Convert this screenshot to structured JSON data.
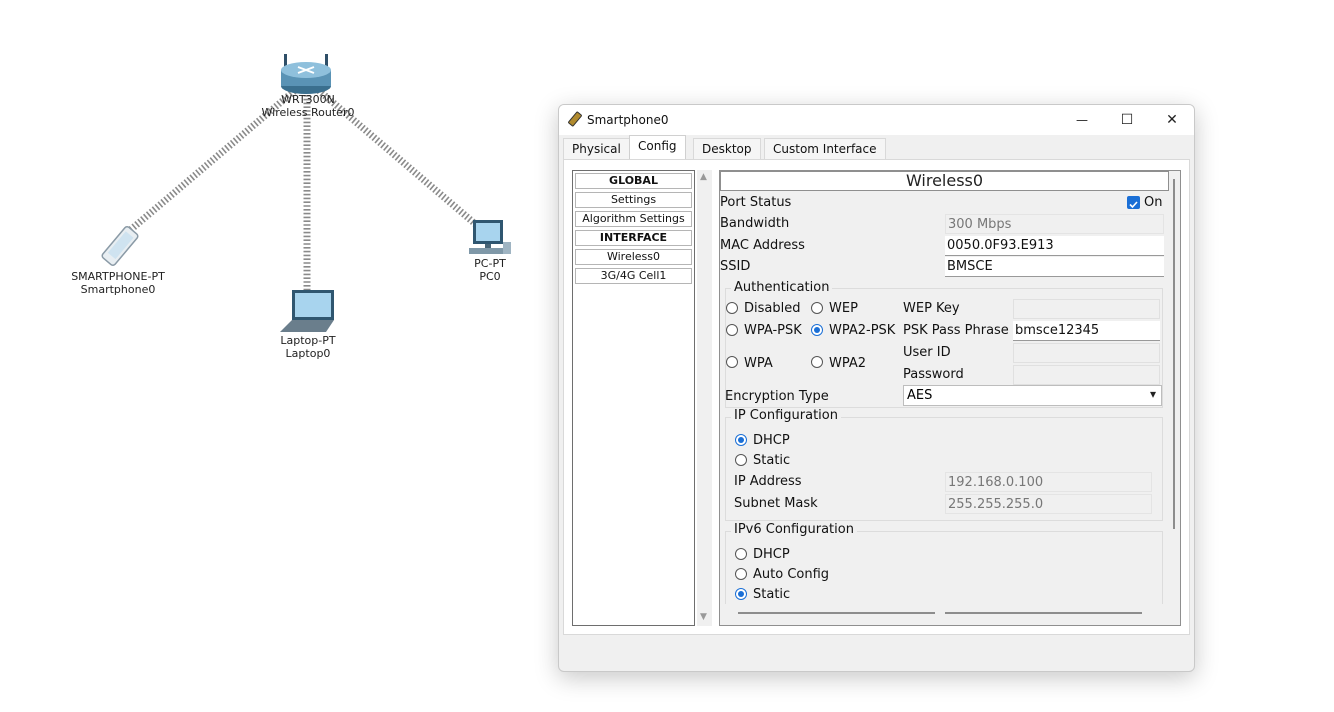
{
  "devices": {
    "router": {
      "line1": "WRT300N",
      "line2": "Wireless Router0"
    },
    "smartphone": {
      "line1": "SMARTPHONE-PT",
      "line2": "Smartphone0"
    },
    "laptop": {
      "line1": "Laptop-PT",
      "line2": "Laptop0"
    },
    "pc": {
      "line1": "PC-PT",
      "line2": "PC0"
    }
  },
  "window": {
    "title": "Smartphone0",
    "minimize_glyph": "—",
    "maximize_glyph": "☐",
    "close_glyph": "✕",
    "tabs": [
      "Physical",
      "Config",
      "Desktop",
      "Custom Interface"
    ],
    "active_tab": "Config"
  },
  "nav": {
    "items": [
      {
        "label": "GLOBAL",
        "header": true
      },
      {
        "label": "Settings",
        "header": false
      },
      {
        "label": "Algorithm Settings",
        "header": false
      },
      {
        "label": "INTERFACE",
        "header": true
      },
      {
        "label": "Wireless0",
        "header": false
      },
      {
        "label": "3G/4G Cell1",
        "header": false
      }
    ],
    "scroll_up": "▲",
    "scroll_down": "▼"
  },
  "panel": {
    "title": "Wireless0",
    "port_status": {
      "label": "Port Status",
      "checkbox_label": "On",
      "checked": true
    },
    "bandwidth": {
      "label": "Bandwidth",
      "value": "300 Mbps"
    },
    "mac": {
      "label": "MAC Address",
      "value": "0050.0F93.E913"
    },
    "ssid": {
      "label": "SSID",
      "value": "BMSCE"
    },
    "auth": {
      "title": "Authentication",
      "options": [
        "Disabled",
        "WEP",
        "WPA-PSK",
        "WPA2-PSK",
        "WPA",
        "WPA2"
      ],
      "selected": "WPA2-PSK",
      "wep_key_label": "WEP Key",
      "psk_label": "PSK Pass Phrase",
      "psk_value": "bmsce12345",
      "userid_label": "User ID",
      "password_label": "Password"
    },
    "encryption": {
      "label": "Encryption Type",
      "value": "AES",
      "arrow": "▾"
    },
    "ip_config": {
      "title": "IP Configuration",
      "dhcp_label": "DHCP",
      "static_label": "Static",
      "selected": "DHCP",
      "ip_label": "IP Address",
      "ip_value": "192.168.0.100",
      "mask_label": "Subnet Mask",
      "mask_value": "255.255.255.0"
    },
    "ipv6_config": {
      "title": "IPv6 Configuration",
      "dhcp_label": "DHCP",
      "auto_label": "Auto Config",
      "static_label": "Static",
      "selected": "Static"
    }
  },
  "colors": {
    "accent": "#1a6fd6",
    "link_line": "#9a9a9a"
  }
}
